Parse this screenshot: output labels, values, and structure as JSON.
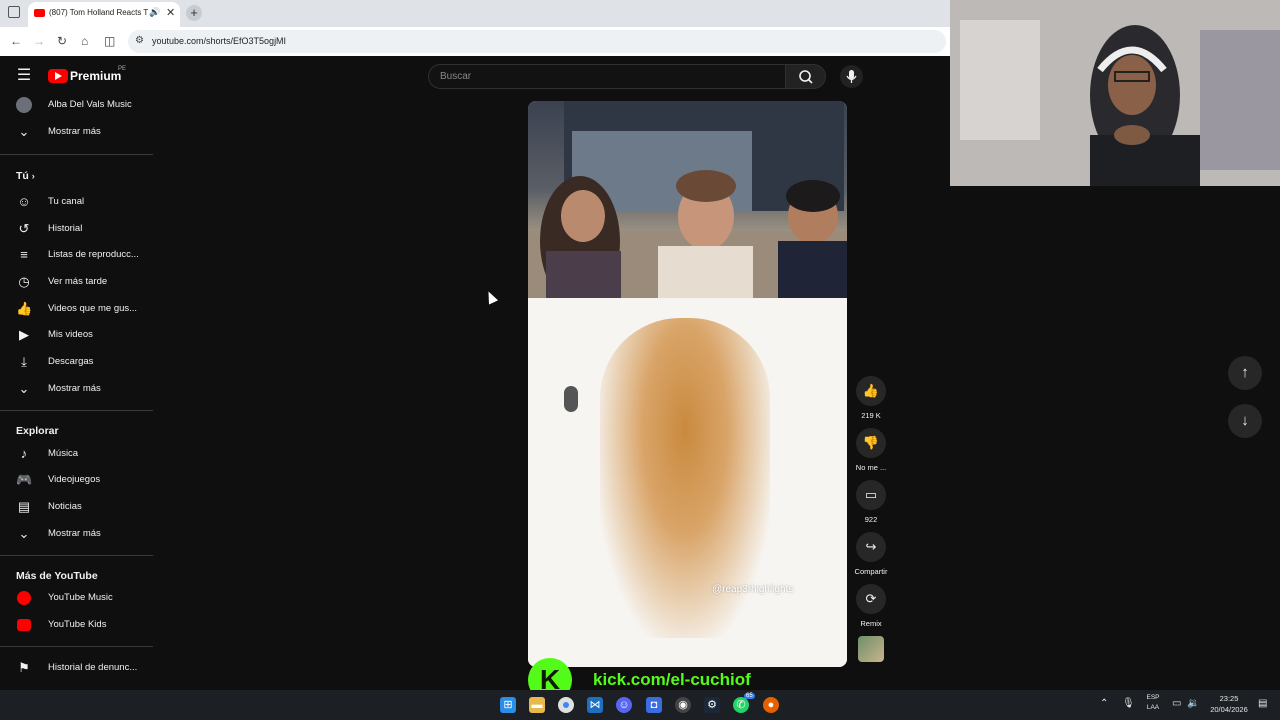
{
  "browser": {
    "tab_title": "(807) Tom Holland Reacts T",
    "new_tab_label": "+",
    "close_label": "✕",
    "url": "youtube.com/shorts/EfO3T5ogjMI"
  },
  "youtube": {
    "logo_text": "Premium",
    "logo_badge": "PE",
    "search_placeholder": "Buscar"
  },
  "sidebar": {
    "subscriptions": [
      {
        "label": "Alba Del Vals Music",
        "icon": "avatar"
      },
      {
        "label": "Mostrar más",
        "icon": "chevron-down-icon"
      }
    ],
    "you_heading": "Tú",
    "you_items": [
      {
        "label": "Tu canal",
        "icon": "channel-icon"
      },
      {
        "label": "Historial",
        "icon": "history-icon"
      },
      {
        "label": "Listas de reproducc...",
        "icon": "playlist-icon"
      },
      {
        "label": "Ver más tarde",
        "icon": "clock-icon"
      },
      {
        "label": "Videos que me gus...",
        "icon": "like-icon"
      },
      {
        "label": "Mis videos",
        "icon": "video-icon"
      },
      {
        "label": "Descargas",
        "icon": "download-icon"
      },
      {
        "label": "Mostrar más",
        "icon": "chevron-down-icon"
      }
    ],
    "explore_heading": "Explorar",
    "explore_items": [
      {
        "label": "Música",
        "icon": "music-icon"
      },
      {
        "label": "Videojuegos",
        "icon": "gaming-icon"
      },
      {
        "label": "Noticias",
        "icon": "news-icon"
      },
      {
        "label": "Mostrar más",
        "icon": "chevron-down-icon"
      }
    ],
    "more_heading": "Más de YouTube",
    "more_items": [
      {
        "label": "YouTube Music",
        "icon": "youtube-music-icon"
      },
      {
        "label": "YouTube Kids",
        "icon": "youtube-kids-icon"
      }
    ],
    "report_history": "Historial de denunc..."
  },
  "short": {
    "watermark": "@reap3rhighlights",
    "actions": {
      "like_count": "219 K",
      "dislike_label": "No me ...",
      "comment_count": "922",
      "share_label": "Compartir",
      "remix_label": "Remix"
    }
  },
  "overlay": {
    "kick_letter": "K",
    "kick_text": "kick.com/el-cuchiof"
  },
  "taskbar": {
    "lang_top": "ESP",
    "lang_bottom": "LAA",
    "time": "23:25",
    "date": "20/04/2026",
    "badge_count": "65"
  },
  "colors": {
    "youtube_red": "#ff0000",
    "kick_green": "#53fc18",
    "background": "#0f0f0f"
  }
}
